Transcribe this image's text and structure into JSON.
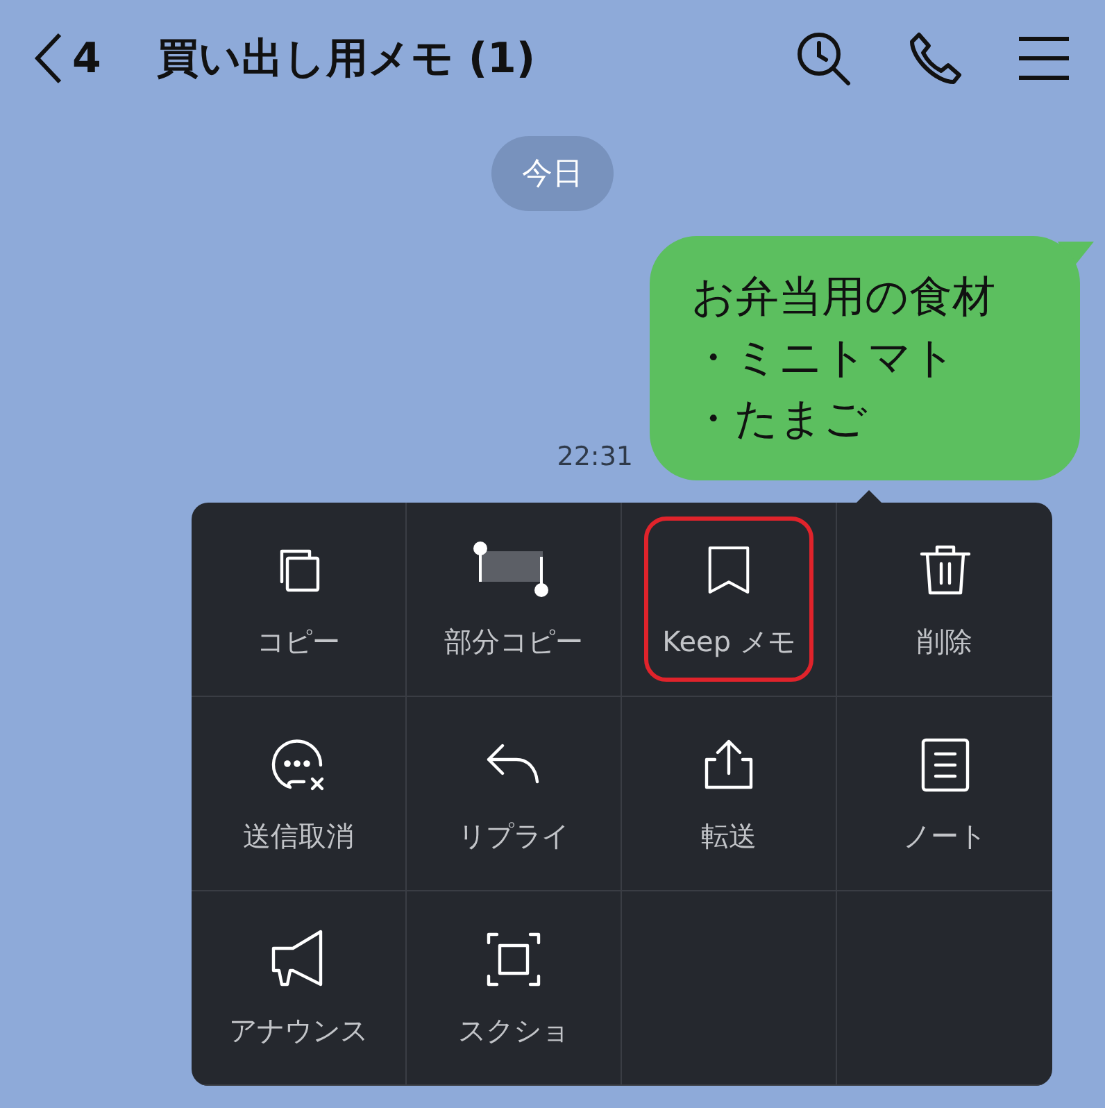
{
  "header": {
    "back_count": "4",
    "title": "買い出し用メモ (1)"
  },
  "date_chip": "今日",
  "message": {
    "lines": [
      "お弁当用の食材",
      "・ミニトマト",
      "・たまご"
    ],
    "time": "22:31"
  },
  "menu": [
    {
      "kind": "copy",
      "label": "コピー",
      "highlighted": false
    },
    {
      "kind": "partial-copy",
      "label": "部分コピー",
      "highlighted": false
    },
    {
      "kind": "bookmark",
      "label": "Keep メモ",
      "highlighted": true
    },
    {
      "kind": "trash",
      "label": "削除",
      "highlighted": false
    },
    {
      "kind": "unsend",
      "label": "送信取消",
      "highlighted": false
    },
    {
      "kind": "reply",
      "label": "リプライ",
      "highlighted": false
    },
    {
      "kind": "share",
      "label": "転送",
      "highlighted": false
    },
    {
      "kind": "note",
      "label": "ノート",
      "highlighted": false
    },
    {
      "kind": "announce",
      "label": "アナウンス",
      "highlighted": false
    },
    {
      "kind": "screenshot",
      "label": "スクショ",
      "highlighted": false
    }
  ]
}
